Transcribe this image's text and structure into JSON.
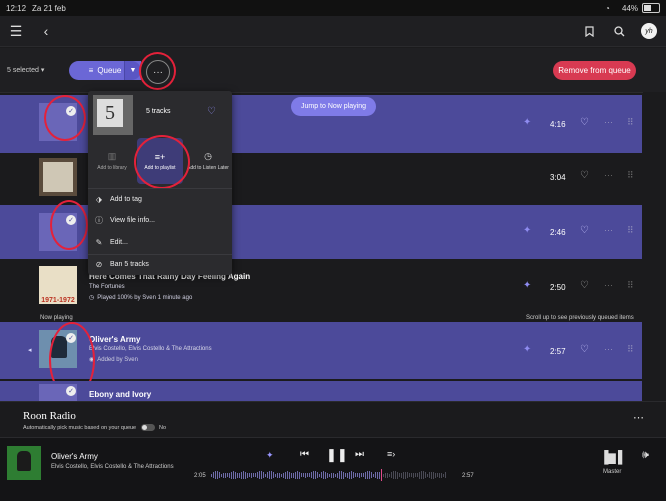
{
  "status": {
    "time": "12:12",
    "date": "Za 21 feb",
    "battery": "44%"
  },
  "topbar": {
    "menu_icon": "hamburger-icon",
    "back_icon": "back-icon",
    "avatar": "yh"
  },
  "selection": {
    "count": "5 selected",
    "queue_label": "Queue",
    "remove_label": "Remove from queue"
  },
  "menu": {
    "tracks_count": "5",
    "tracks_label": "5 tracks",
    "quick": [
      {
        "label": "Add to library"
      },
      {
        "label": "Add to playlist"
      },
      {
        "label": "Add to Listen Later"
      }
    ],
    "items": [
      {
        "label": "Add to tag"
      },
      {
        "label": "View file info..."
      },
      {
        "label": "Edit..."
      },
      {
        "label": "Ban 5 tracks"
      }
    ]
  },
  "jump_label": "Jump to Now playing",
  "tracks": [
    {
      "duration": "4:16"
    },
    {
      "duration": "3:04"
    },
    {
      "duration": "2:46"
    },
    {
      "title": "Here Comes That Rainy Day Feeling Again",
      "artist": "The Fortunes",
      "sub": "Played 100% by Sven 1 minute ago",
      "duration": "2:50",
      "art_text": "1971-1972"
    },
    {
      "title": "Oliver's Army",
      "artist": "Elvis Costello, Elvis Costello & The Attractions",
      "sub": "Added by Sven",
      "duration": "2:57"
    },
    {
      "title": "Ebony and Ivory"
    }
  ],
  "divider": {
    "now_playing": "Now playing",
    "scroll_hint": "Scroll up to see previously queued items"
  },
  "radio": {
    "title": "Roon Radio",
    "desc": "Automatically pick music based on your queue",
    "toggle": "No"
  },
  "player": {
    "title": "Oliver's Army",
    "artist": "Elvis Costello, Elvis Costello & The Attractions",
    "elapsed": "2:05",
    "total": "2:57",
    "progress": 0.72,
    "zone": "Master"
  },
  "colors": {
    "selected_row": "#4c4a9a",
    "accent": "#6b67d6",
    "danger": "#d83a52",
    "annotation": "#e4213a"
  }
}
